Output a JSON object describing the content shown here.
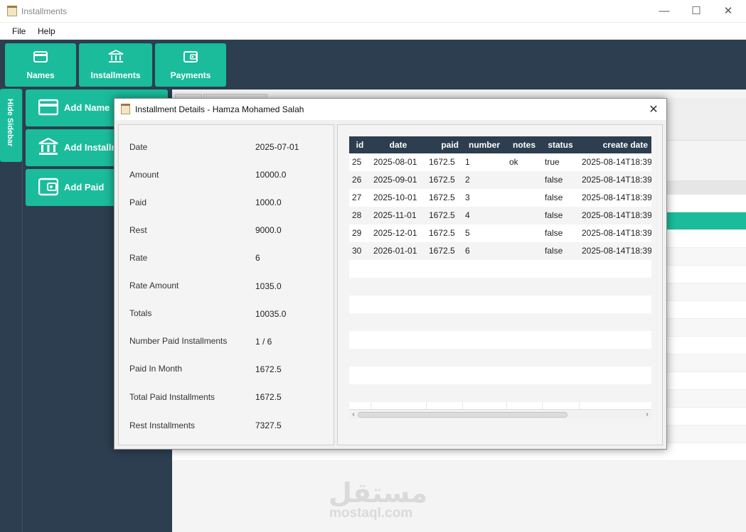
{
  "window": {
    "title": "Installments",
    "min_icon": "minimize-icon",
    "max_icon": "maximize-icon",
    "close_icon": "close-icon"
  },
  "menu": [
    "File",
    "Help"
  ],
  "top_tabs": [
    {
      "label": "Names",
      "icon": "card-icon"
    },
    {
      "label": "Installments",
      "icon": "bank-icon"
    },
    {
      "label": "Payments",
      "icon": "wallet-icon"
    }
  ],
  "sidebar": {
    "toggle_label": "Hide Sidebar",
    "items": [
      {
        "label": "Add Name",
        "icon": "card-icon"
      },
      {
        "label": "Add Installment",
        "icon": "bank-icon"
      },
      {
        "label": "Add Paid",
        "icon": "wallet-icon"
      }
    ]
  },
  "watermark": {
    "arabic": "مستقل",
    "latin": "mostaql.com"
  },
  "dialog": {
    "title": "Installment Details - Hamza Mohamed Salah",
    "details": [
      {
        "label": "Date",
        "value": "2025-07-01"
      },
      {
        "label": "Amount",
        "value": "10000.0"
      },
      {
        "label": "Paid",
        "value": "1000.0"
      },
      {
        "label": "Rest",
        "value": "9000.0"
      },
      {
        "label": "Rate",
        "value": "6"
      },
      {
        "label": "Rate Amount",
        "value": "1035.0"
      },
      {
        "label": "Totals",
        "value": "10035.0"
      },
      {
        "label": "Number Paid Installments",
        "value": "1 / 6"
      },
      {
        "label": "Paid In Month",
        "value": "1672.5"
      },
      {
        "label": "Total Paid Installments",
        "value": "1672.5"
      },
      {
        "label": "Rest Installments",
        "value": "7327.5"
      }
    ],
    "table": {
      "columns": [
        "id",
        "date",
        "paid",
        "number",
        "notes",
        "status",
        "create date"
      ],
      "rows": [
        [
          "25",
          "2025-08-01",
          "1672.5",
          "1",
          "ok",
          "true",
          "2025-08-14T18:39:"
        ],
        [
          "26",
          "2025-09-01",
          "1672.5",
          "2",
          "",
          "false",
          "2025-08-14T18:39:"
        ],
        [
          "27",
          "2025-10-01",
          "1672.5",
          "3",
          "",
          "false",
          "2025-08-14T18:39:"
        ],
        [
          "28",
          "2025-11-01",
          "1672.5",
          "4",
          "",
          "false",
          "2025-08-14T18:39:"
        ],
        [
          "29",
          "2025-12-01",
          "1672.5",
          "5",
          "",
          "false",
          "2025-08-14T18:39:"
        ],
        [
          "30",
          "2026-01-01",
          "1672.5",
          "6",
          "",
          "false",
          "2025-08-14T18:39:"
        ]
      ]
    }
  },
  "colors": {
    "accent": "#1abc9c",
    "dark": "#2c3e50",
    "table_header": "#2c3e50"
  }
}
